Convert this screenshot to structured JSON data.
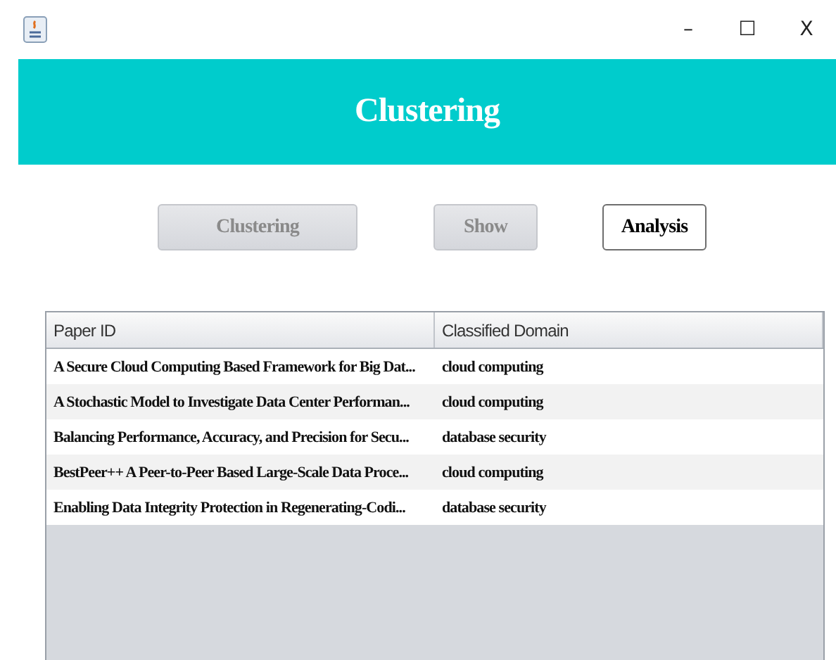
{
  "window": {
    "controls": [
      "–",
      "☐",
      "X"
    ]
  },
  "banner": {
    "title": "Clustering"
  },
  "buttons": [
    {
      "label": "Clustering",
      "disabled": true
    },
    {
      "label": "Show",
      "disabled": true
    },
    {
      "label": "Analysis",
      "disabled": false
    }
  ],
  "table": {
    "columns": [
      "Paper ID",
      "Classified Domain"
    ],
    "rows": [
      [
        "A Secure Cloud Computing Based Framework for Big Dat...",
        "cloud computing"
      ],
      [
        "A Stochastic Model to Investigate Data Center Performan...",
        "cloud computing"
      ],
      [
        "Balancing Performance, Accuracy, and Precision for Secu...",
        "database security"
      ],
      [
        "BestPeer++ A Peer-to-Peer Based Large-Scale Data Proce...",
        "cloud computing"
      ],
      [
        "Enabling Data Integrity Protection in Regenerating-Codi...",
        "database security"
      ]
    ]
  }
}
